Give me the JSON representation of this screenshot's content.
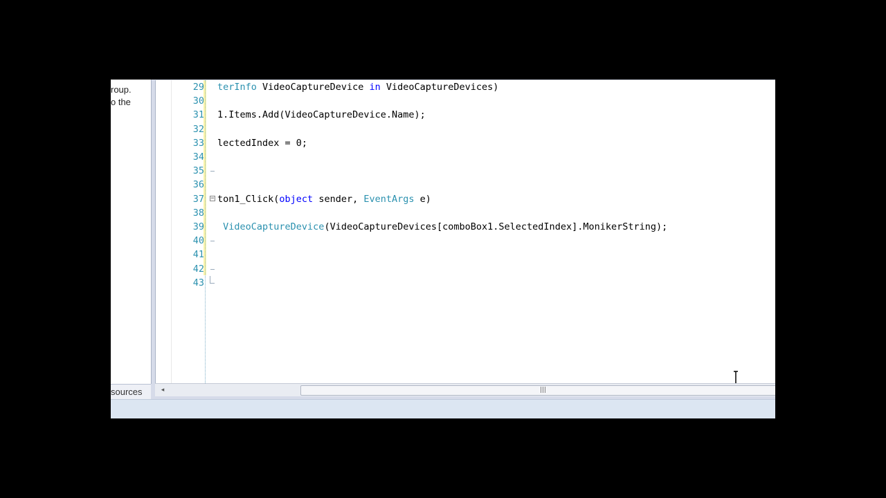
{
  "left_panel": {
    "text_lines": [
      "roup.",
      "o the"
    ],
    "tab_label": "sources"
  },
  "editor": {
    "lines": [
      {
        "num": "29",
        "tokens": [
          {
            "t": "terInfo",
            "c": "ty"
          },
          {
            "t": " VideoCaptureDevice ",
            "c": ""
          },
          {
            "t": "in",
            "c": "kw"
          },
          {
            "t": " VideoCaptureDevices)",
            "c": ""
          }
        ]
      },
      {
        "num": "30",
        "tokens": []
      },
      {
        "num": "31",
        "tokens": [
          {
            "t": "1.Items.Add(VideoCaptureDevice.Name);",
            "c": ""
          }
        ]
      },
      {
        "num": "32",
        "tokens": []
      },
      {
        "num": "33",
        "tokens": [
          {
            "t": "lectedIndex = 0;",
            "c": ""
          }
        ]
      },
      {
        "num": "34",
        "tokens": []
      },
      {
        "num": "35",
        "tokens": []
      },
      {
        "num": "36",
        "tokens": []
      },
      {
        "num": "37",
        "tokens": [
          {
            "t": "ton1_Click(",
            "c": ""
          },
          {
            "t": "object",
            "c": "kw"
          },
          {
            "t": " sender, ",
            "c": ""
          },
          {
            "t": "EventArgs",
            "c": "ty"
          },
          {
            "t": " e)",
            "c": ""
          }
        ]
      },
      {
        "num": "38",
        "tokens": []
      },
      {
        "num": "39",
        "tokens": [
          {
            "t": " ",
            "c": ""
          },
          {
            "t": "VideoCaptureDevice",
            "c": "ty"
          },
          {
            "t": "(VideoCaptureDevices[comboBox1.SelectedIndex].MonikerString);",
            "c": ""
          }
        ]
      },
      {
        "num": "40",
        "tokens": []
      },
      {
        "num": "41",
        "tokens": []
      },
      {
        "num": "42",
        "tokens": []
      },
      {
        "num": "43",
        "tokens": []
      }
    ]
  },
  "scrollbar": {
    "left_arrow": "◂",
    "grip": "|||"
  },
  "colors": {
    "keyword": "#0000ff",
    "type": "#2b91af",
    "line_number": "#2b91af",
    "changed_line_bar": "#fff6a8"
  }
}
